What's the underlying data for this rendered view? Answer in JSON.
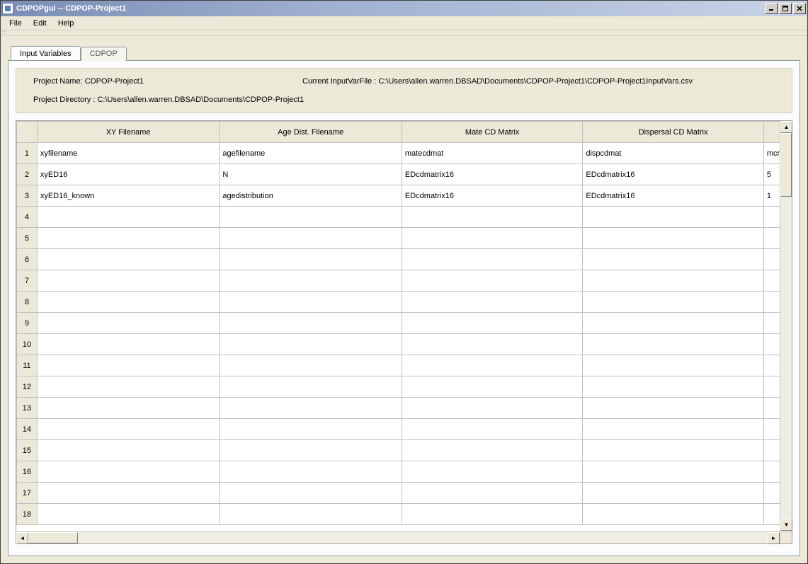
{
  "window": {
    "title": "CDPOPgui -- CDPOP-Project1"
  },
  "menu": {
    "file": "File",
    "edit": "Edit",
    "help": "Help"
  },
  "tabs": {
    "input_variables": "Input Variables",
    "cdpop": "CDPOP"
  },
  "info": {
    "project_name_label": "Project Name:",
    "project_name_value": "CDPOP-Project1",
    "input_var_file_label": "Current InputVarFile :",
    "input_var_file_value": "C:\\Users\\allen.warren.DBSAD\\Documents\\CDPOP-Project1\\CDPOP-Project1InputVars.csv",
    "project_dir_label": "Project Directory :",
    "project_dir_value": "C:\\Users\\allen.warren.DBSAD\\Documents\\CDPOP-Project1"
  },
  "grid": {
    "headers": {
      "xy": "XY Filename",
      "age": "Age Dist. Filename",
      "mate": "Mate CD Matrix",
      "disp": "Dispersal CD Matrix"
    },
    "rows": [
      {
        "n": "1",
        "xy": "xyfilename",
        "age": "agefilename",
        "mate": "matecdmat",
        "disp": "dispcdmat",
        "extra": "mcruns"
      },
      {
        "n": "2",
        "xy": "xyED16",
        "age": "N",
        "mate": "EDcdmatrix16",
        "disp": "EDcdmatrix16",
        "extra": "5"
      },
      {
        "n": "3",
        "xy": "xyED16_known",
        "age": "agedistribution",
        "mate": "EDcdmatrix16",
        "disp": "EDcdmatrix16",
        "extra": "1"
      },
      {
        "n": "4",
        "xy": "",
        "age": "",
        "mate": "",
        "disp": "",
        "extra": ""
      },
      {
        "n": "5",
        "xy": "",
        "age": "",
        "mate": "",
        "disp": "",
        "extra": ""
      },
      {
        "n": "6",
        "xy": "",
        "age": "",
        "mate": "",
        "disp": "",
        "extra": ""
      },
      {
        "n": "7",
        "xy": "",
        "age": "",
        "mate": "",
        "disp": "",
        "extra": ""
      },
      {
        "n": "8",
        "xy": "",
        "age": "",
        "mate": "",
        "disp": "",
        "extra": ""
      },
      {
        "n": "9",
        "xy": "",
        "age": "",
        "mate": "",
        "disp": "",
        "extra": ""
      },
      {
        "n": "10",
        "xy": "",
        "age": "",
        "mate": "",
        "disp": "",
        "extra": ""
      },
      {
        "n": "11",
        "xy": "",
        "age": "",
        "mate": "",
        "disp": "",
        "extra": ""
      },
      {
        "n": "12",
        "xy": "",
        "age": "",
        "mate": "",
        "disp": "",
        "extra": ""
      },
      {
        "n": "13",
        "xy": "",
        "age": "",
        "mate": "",
        "disp": "",
        "extra": ""
      },
      {
        "n": "14",
        "xy": "",
        "age": "",
        "mate": "",
        "disp": "",
        "extra": ""
      },
      {
        "n": "15",
        "xy": "",
        "age": "",
        "mate": "",
        "disp": "",
        "extra": ""
      },
      {
        "n": "16",
        "xy": "",
        "age": "",
        "mate": "",
        "disp": "",
        "extra": ""
      },
      {
        "n": "17",
        "xy": "",
        "age": "",
        "mate": "",
        "disp": "",
        "extra": ""
      },
      {
        "n": "18",
        "xy": "",
        "age": "",
        "mate": "",
        "disp": "",
        "extra": ""
      }
    ]
  }
}
